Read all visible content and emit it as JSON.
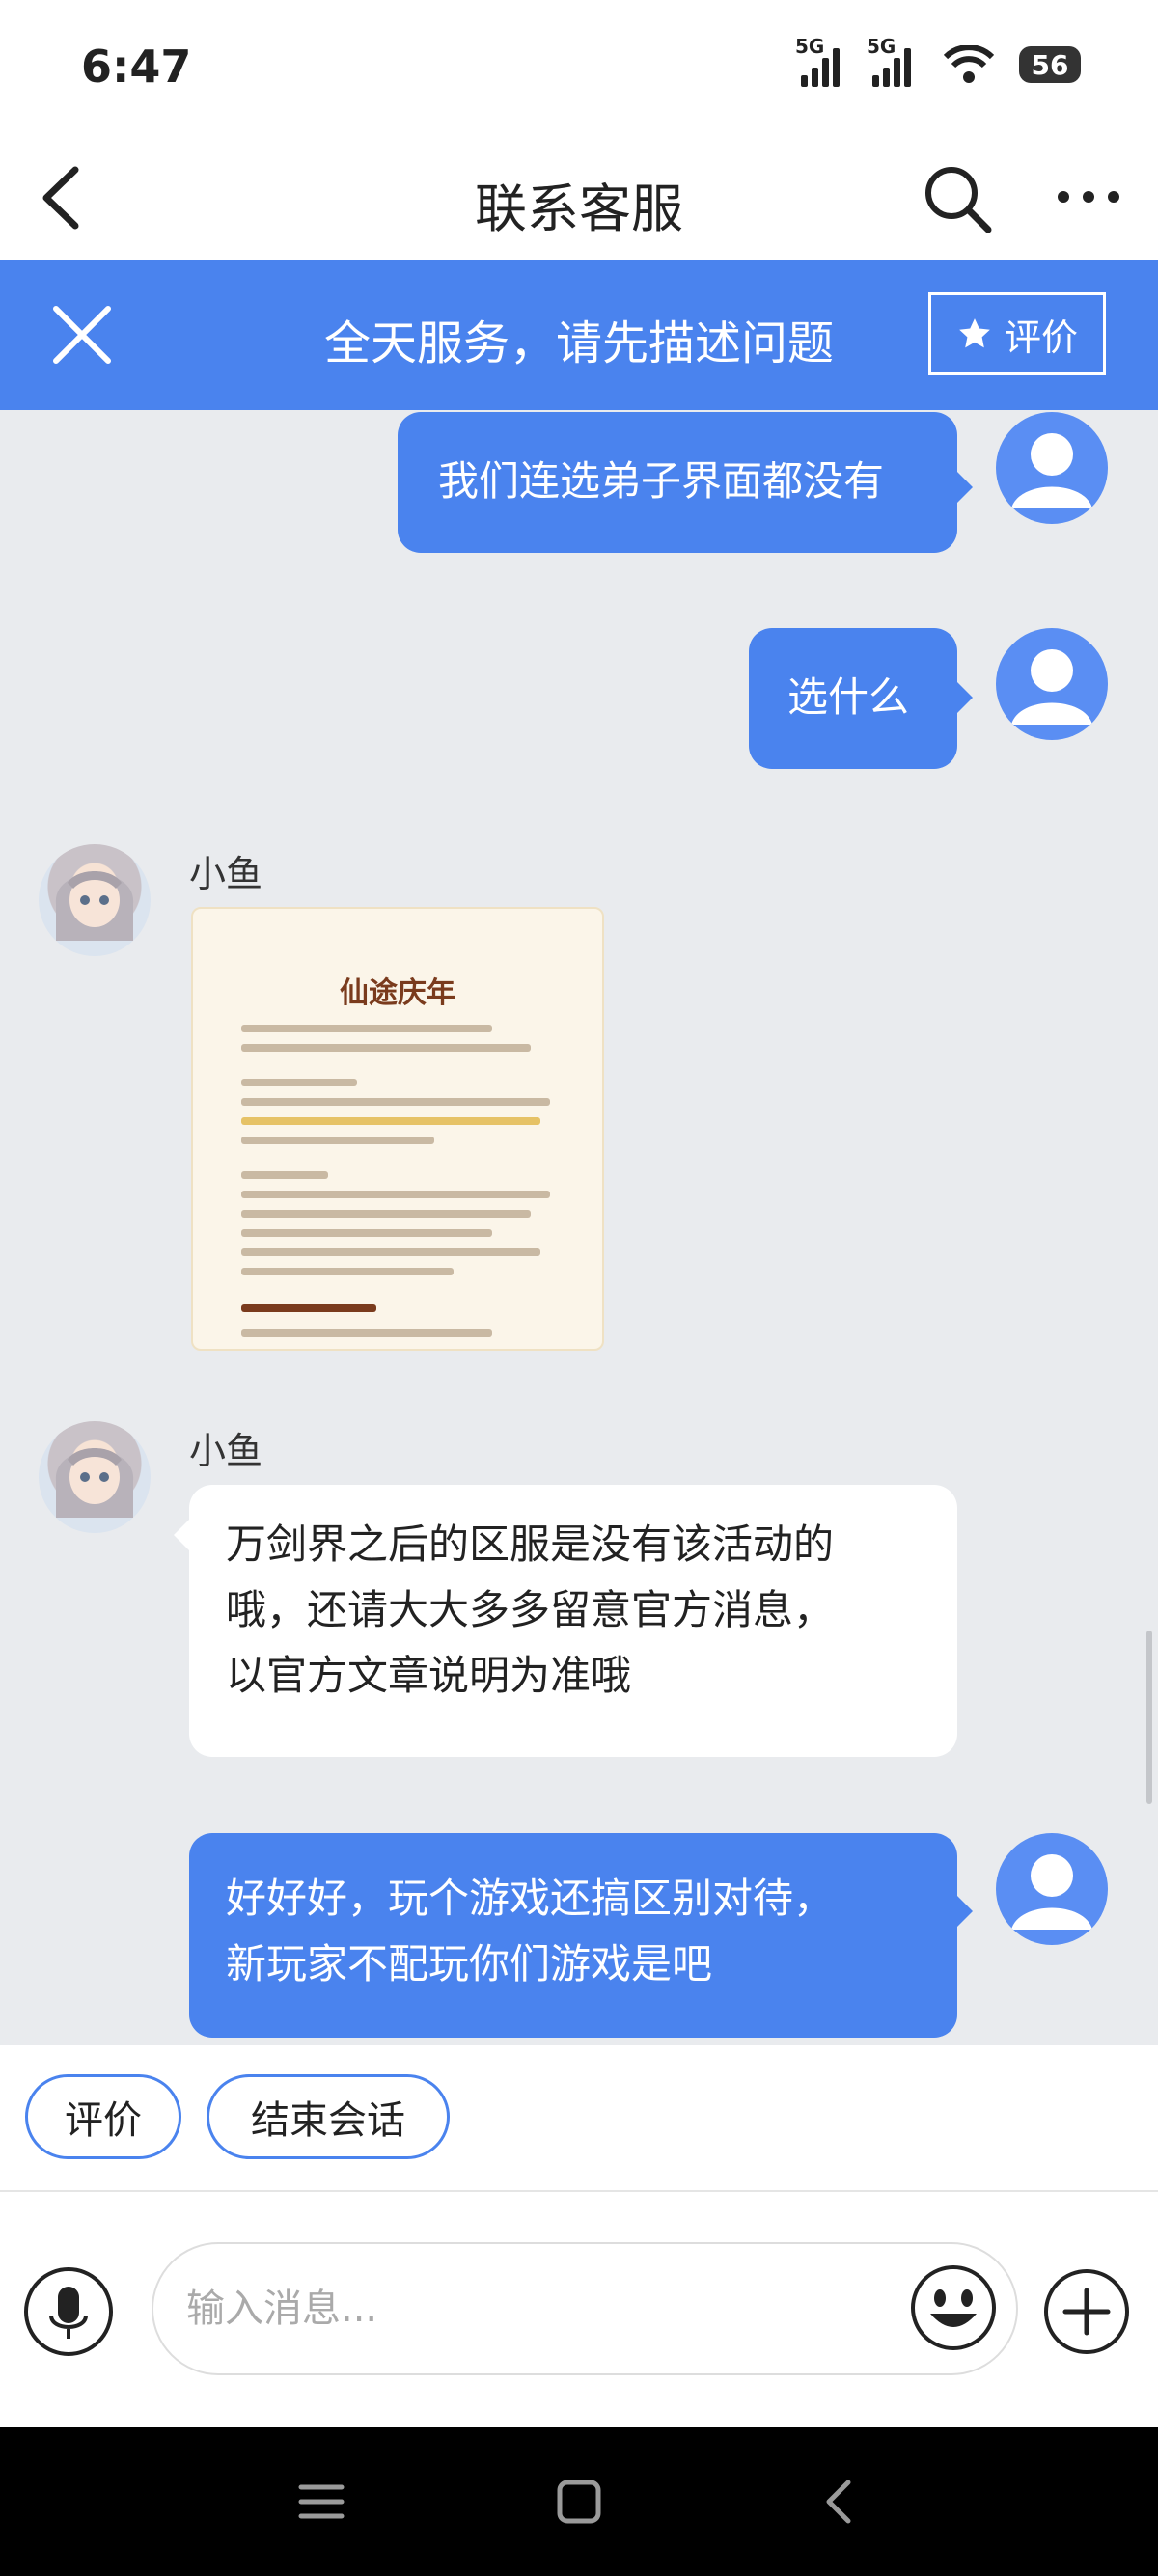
{
  "status_bar": {
    "time": "6:47",
    "signal1": "5G",
    "signal2": "5G",
    "battery": "56"
  },
  "header": {
    "title": "联系客服"
  },
  "banner": {
    "text": "全天服务，请先描述问题",
    "rate_label": "评价"
  },
  "messages": [
    {
      "from": "user",
      "text": "我们连选弟子界面都没有"
    },
    {
      "from": "user",
      "text": "选什么"
    },
    {
      "from": "agent",
      "sender": "小鱼",
      "type": "image",
      "image_title": "仙途庆年"
    },
    {
      "from": "agent",
      "sender": "小鱼",
      "lines": [
        "万剑界之后的区服是没有该活动的",
        "哦，还请大大多多留意官方消息，",
        "以官方文章说明为准哦"
      ]
    },
    {
      "from": "user",
      "lines": [
        "好好好，玩个游戏还搞区别对待，",
        "新玩家不配玩你们游戏是吧"
      ]
    }
  ],
  "quick_actions": [
    "评价",
    "结束会话"
  ],
  "input": {
    "placeholder": "输入消息..."
  },
  "colors": {
    "accent": "#4a83ee",
    "chat_bg": "#e9ebee"
  }
}
